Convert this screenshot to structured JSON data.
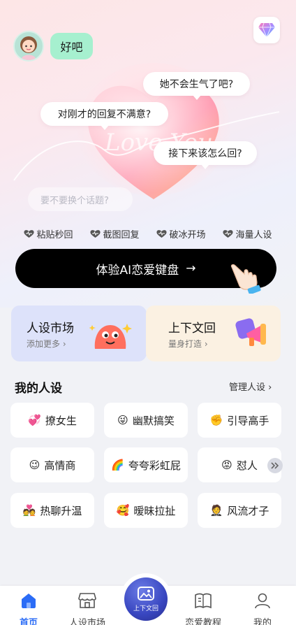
{
  "header": {
    "reply_text": "好吧",
    "questions": [
      "她不会生气了吧?",
      "对刚才的回复不满意?",
      "接下来该怎么回?"
    ],
    "input_placeholder": "要不要换个话题?",
    "decor_text": "Love You"
  },
  "features": [
    "粘贴秒回",
    "截图回复",
    "破冰开场",
    "海量人设"
  ],
  "cta": {
    "label": "体验AI恋爱键盘",
    "arrow": "→"
  },
  "cards": [
    {
      "title": "人设市场",
      "sub": "添加更多 ›",
      "bg": "#dde2fa"
    },
    {
      "title": "上下文回",
      "sub": "量身打造 ›",
      "bg": "#fbf1e2"
    }
  ],
  "my_personas": {
    "title": "我的人设",
    "manage_label": "管理人设 ›",
    "items": [
      {
        "emoji": "💞",
        "label": "撩女生"
      },
      {
        "emoji": "😜",
        "label": "幽默搞笑"
      },
      {
        "emoji": "✊",
        "label": "引导高手"
      },
      {
        "emoji": "😉",
        "label": "高情商"
      },
      {
        "emoji": "🌈",
        "label": "夸夸彩虹屁"
      },
      {
        "emoji": "😡",
        "label": "怼人"
      },
      {
        "emoji": "💑",
        "label": "热聊升温"
      },
      {
        "emoji": "🥰",
        "label": "暧昧拉扯"
      },
      {
        "emoji": "🤵",
        "label": "风流才子"
      }
    ]
  },
  "tabbar": {
    "tabs": [
      "首页",
      "人设市场",
      "上下文回",
      "恋爱教程",
      "我的"
    ],
    "active": "首页"
  },
  "colors": {
    "accent": "#2b6cf6",
    "cta_bg": "#000000",
    "reply_bubble": "#a6f0cf"
  },
  "icons": [
    "diamond-icon",
    "heart-icon",
    "arrow-right-icon",
    "hand-pointer-icon",
    "double-chevron-icon",
    "home-icon",
    "store-icon",
    "image-context-icon",
    "book-icon",
    "user-icon"
  ]
}
